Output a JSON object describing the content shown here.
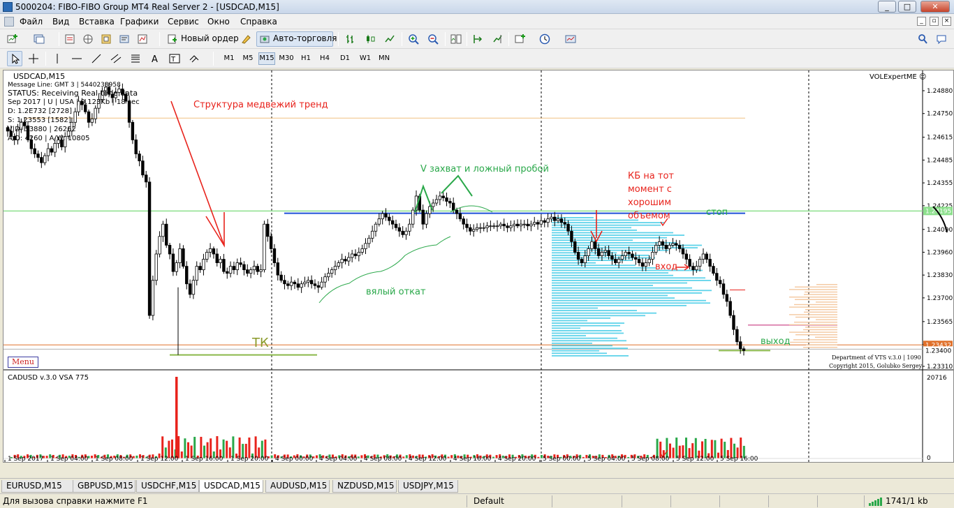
{
  "window": {
    "title": "5000204: FIBO-FIBO Group MT4 Real Server 2 - [USDCAD,M15]",
    "min_glyph": "_",
    "max_glyph": "□",
    "close_glyph": "✕"
  },
  "menu": {
    "items": [
      "Файл",
      "Вид",
      "Вставка",
      "Графики",
      "Сервис",
      "Окно",
      "Справка"
    ]
  },
  "toolbar": {
    "new_order_label": "Новый ордер",
    "autotrade_label": "Авто-торговля",
    "timeframes": [
      "M1",
      "M5",
      "M15",
      "M30",
      "H1",
      "H4",
      "D1",
      "W1",
      "MN"
    ],
    "active_timeframe": "M15"
  },
  "chart": {
    "symbol_label": "USDCAD,M15",
    "info_lines": [
      "Message Line: GMT 3 | 5440238958",
      "STATUS:  Receiving Real-time data",
      "Sep 2017 | U | USA | 0.123Kb | 18 sec",
      "D: 1.2E732  [2728]",
      "S: 1.23553  [1582]",
      "V|D: 53880 | 26262",
      "A/D: 4260 | A/W: 10805"
    ],
    "expert_label": "VOLExpertME ☺",
    "menu_button": "Menu",
    "copyright_1": "Department of VTS  v.3.0 | 1090",
    "copyright_2": "Copyright 2015, Golubko Sergey",
    "price_axis": [
      "1.24880",
      "1.24750",
      "1.24615",
      "1.24485",
      "1.24355",
      "1.24225",
      "1.24090",
      "1.23960",
      "1.23830",
      "1.23700",
      "1.23565",
      "1.23435",
      "1.23310"
    ],
    "price_tags": {
      "green": "1.24195",
      "orange": "1.23432",
      "current": "1.23400"
    },
    "time_axis": [
      "1 Sep 2017",
      "1 Sep 04:00",
      "1 Sep 08:00",
      "1 Sep 12:00",
      "1 Sep 16:00",
      "1 Sep 20:00",
      "4 Sep 00:00",
      "4 Sep 04:00",
      "4 Sep 08:00",
      "4 Sep 12:00",
      "4 Sep 16:00",
      "4 Sep 20:00",
      "5 Sep 00:00",
      "5 Sep 04:00",
      "5 Sep 08:00",
      "5 Sep 12:00",
      "5 Sep 16:00"
    ]
  },
  "annotations": {
    "bear_trend": "Структура медвежий тренд",
    "v_capture": "V захват и ложный пробой",
    "weak_pullback": "вялый откат",
    "tk": "ТК",
    "kb_lines": [
      "КБ на тот",
      "момент с",
      "хорошим",
      "объемом"
    ],
    "stop": "стоп",
    "entry": "вход",
    "exit": "выход"
  },
  "indicator": {
    "label": "CADUSD  v.3.0 VSA 775",
    "axis_top": "20716",
    "axis_bottom": "0"
  },
  "tabs": {
    "items": [
      "EURUSD,M15",
      "GBPUSD,M15",
      "USDCHF,M15",
      "USDCAD,M15",
      "AUDUSD,M15",
      "NZDUSD,M15",
      "USDJPY,M15"
    ],
    "active": "USDCAD,M15"
  },
  "status": {
    "help": "Для вызова справки нажмите F1",
    "profile": "Default",
    "traffic": "1741/1 kb"
  },
  "colors": {
    "bull_candle": "#ffffff",
    "bear_candle": "#000000",
    "support_line": "#8de08d",
    "resistance_line": "#1f4fd8",
    "annotation_red": "#e8231c",
    "annotation_green": "#2aa84a",
    "volume_profile": "#5fd3ea"
  }
}
